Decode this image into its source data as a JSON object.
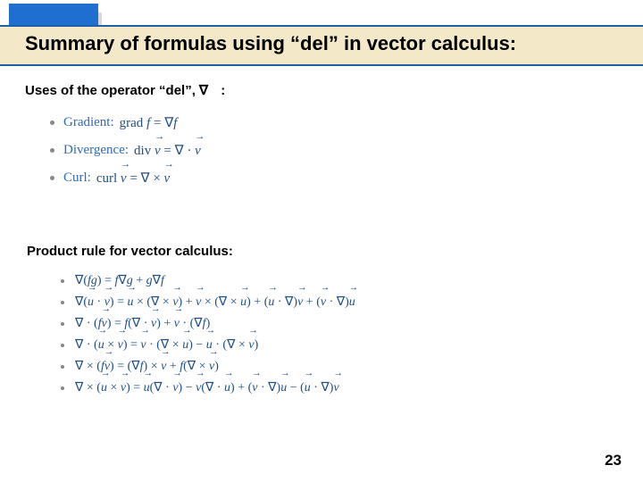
{
  "title": "Summary of formulas using “del” in vector calculus:",
  "subheading_uses_prefix": "Uses of the operator “del”,",
  "subheading_uses_symbol": "∇",
  "subheading_uses_colon": ":",
  "uses": [
    {
      "label": "Gradient:",
      "op": "grad",
      "var_html": "<span class='mvar'>f</span>",
      "rhs_html": "∇<span class='mvar'>f</span>"
    },
    {
      "label": "Divergence:",
      "op": "div",
      "var_html": "<span class='vecwrap'><span class='mvar'>v</span><span class='vecarrow'>→</span></span>",
      "rhs_html": "∇ · <span class='vecwrap'><span class='mvar'>v</span><span class='vecarrow'>→</span></span>"
    },
    {
      "label": "Curl:",
      "op": "curl",
      "var_html": "<span class='vecwrap'><span class='mvar'>v</span><span class='vecarrow'>→</span></span>",
      "rhs_html": "∇ × <span class='vecwrap'><span class='mvar'>v</span><span class='vecarrow'>→</span></span>"
    }
  ],
  "subheading_product": "Product rule for vector calculus:",
  "product_rules_html": [
    "∇(<span class='mvar'>f</span><span class='mvar'>g</span>) = <span class='mvar'>f</span>∇<span class='mvar'>g</span> + <span class='mvar'>g</span>∇<span class='mvar'>f</span>",
    "∇(<span class='vecwrap'><span class='mvar'>u</span><span class='vecarrow'>→</span></span> · <span class='vecwrap'><span class='mvar'>v</span><span class='vecarrow'>→</span></span>) = <span class='vecwrap'><span class='mvar'>u</span><span class='vecarrow'>→</span></span> × (∇ × <span class='vecwrap'><span class='mvar'>v</span><span class='vecarrow'>→</span></span>) + <span class='vecwrap'><span class='mvar'>v</span><span class='vecarrow'>→</span></span> × (∇ × <span class='vecwrap'><span class='mvar'>u</span><span class='vecarrow'>→</span></span>) + (<span class='vecwrap'><span class='mvar'>u</span><span class='vecarrow'>→</span></span> · ∇)<span class='vecwrap'><span class='mvar'>v</span><span class='vecarrow'>→</span></span> + (<span class='vecwrap'><span class='mvar'>v</span><span class='vecarrow'>→</span></span> · ∇)<span class='vecwrap'><span class='mvar'>u</span><span class='vecarrow'>→</span></span>",
    "∇ · (<span class='mvar'>f</span><span class='vecwrap'><span class='mvar'>v</span><span class='vecarrow'>→</span></span>) = <span class='mvar'>f</span>(∇ · <span class='vecwrap'><span class='mvar'>v</span><span class='vecarrow'>→</span></span>) + <span class='vecwrap'><span class='mvar'>v</span><span class='vecarrow'>→</span></span> · (∇<span class='mvar'>f</span>)",
    "∇ · (<span class='vecwrap'><span class='mvar'>u</span><span class='vecarrow'>→</span></span> × <span class='vecwrap'><span class='mvar'>v</span><span class='vecarrow'>→</span></span>) = <span class='vecwrap'><span class='mvar'>v</span><span class='vecarrow'>→</span></span> · (∇ × <span class='vecwrap'><span class='mvar'>u</span><span class='vecarrow'>→</span></span>) − <span class='vecwrap'><span class='mvar'>u</span><span class='vecarrow'>→</span></span> · (∇ × <span class='vecwrap'><span class='mvar'>v</span><span class='vecarrow'>→</span></span>)",
    "∇ × (<span class='mvar'>f</span><span class='vecwrap'><span class='mvar'>v</span><span class='vecarrow'>→</span></span>) = (∇<span class='mvar'>f</span>) × <span class='vecwrap'><span class='mvar'>v</span><span class='vecarrow'>→</span></span> + <span class='mvar'>f</span>(∇ × <span class='vecwrap'><span class='mvar'>v</span><span class='vecarrow'>→</span></span>)",
    "∇ × (<span class='vecwrap'><span class='mvar'>u</span><span class='vecarrow'>→</span></span> × <span class='vecwrap'><span class='mvar'>v</span><span class='vecarrow'>→</span></span>) = <span class='vecwrap'><span class='mvar'>u</span><span class='vecarrow'>→</span></span>(∇ · <span class='vecwrap'><span class='mvar'>v</span><span class='vecarrow'>→</span></span>) − <span class='vecwrap'><span class='mvar'>v</span><span class='vecarrow'>→</span></span>(∇ · <span class='vecwrap'><span class='mvar'>u</span><span class='vecarrow'>→</span></span>) + (<span class='vecwrap'><span class='mvar'>v</span><span class='vecarrow'>→</span></span> · ∇)<span class='vecwrap'><span class='mvar'>u</span><span class='vecarrow'>→</span></span> − (<span class='vecwrap'><span class='mvar'>u</span><span class='vecarrow'>→</span></span> · ∇)<span class='vecwrap'><span class='mvar'>v</span><span class='vecarrow'>→</span></span>"
  ],
  "page_number": "23"
}
